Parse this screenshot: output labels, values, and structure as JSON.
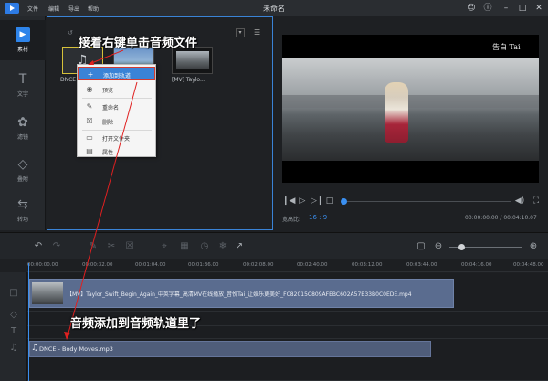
{
  "titlebar": {
    "menus": [
      "文件",
      "编辑",
      "导出",
      "帮助"
    ],
    "title": "未命名"
  },
  "sidebar": {
    "items": [
      {
        "label": "素材",
        "icon": "media-icon"
      },
      {
        "label": "文字",
        "icon": "text-icon"
      },
      {
        "label": "滤镜",
        "icon": "filter-icon"
      },
      {
        "label": "叠附",
        "icon": "overlay-icon"
      },
      {
        "label": "转场",
        "icon": "transition-icon"
      }
    ]
  },
  "media": {
    "items": [
      {
        "label": "DNCE"
      },
      {
        "label": ""
      },
      {
        "label": "[MV] Taylo..."
      }
    ]
  },
  "context_menu": {
    "items": [
      "添加到轨道",
      "预览",
      "重命名",
      "删除",
      "打开文件夹",
      "属性"
    ]
  },
  "callouts": {
    "top": "接着右键单击音频文件",
    "bottom": "音频添加到音频轨道里了"
  },
  "preview": {
    "watermark": "告白 Tai",
    "aspect_label": "宽高比:",
    "aspect_value": "16 : 9",
    "time": "00:00:00.00 / 00:04:10.07"
  },
  "timeline": {
    "ticks": [
      "00:00:00.00",
      "00:00:32.00",
      "00:01:04.00",
      "00:01:36.00",
      "00:02:08.00",
      "00:02:40.00",
      "00:03:12.00",
      "00:03:44.00",
      "00:04:16.00",
      "00:04:48.00"
    ],
    "video_clip": "【MV】Taylor_Swift_Begin_Again_中英字幕_高清MV在线播放_音悦Tai_让娱乐更美好_FC82015C809AFEBC602A57B33B0C0EDE.mp4",
    "audio_clip": "DNCE - Body Moves.mp3"
  }
}
